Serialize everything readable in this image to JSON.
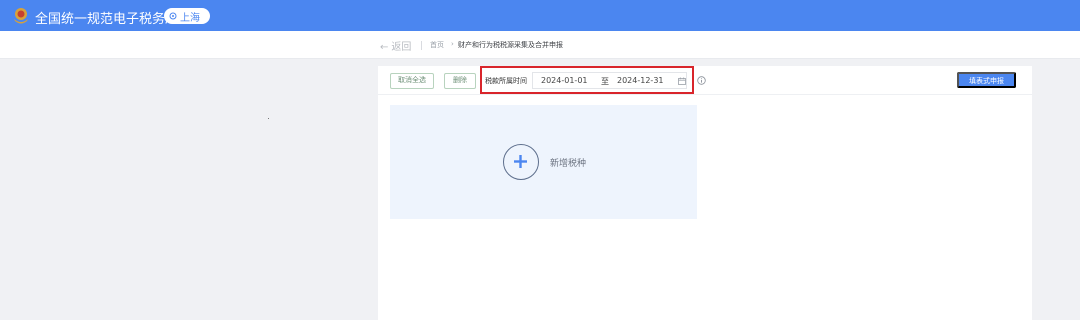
{
  "header": {
    "title": "全国统一规范电子税务局",
    "region": "上海",
    "emblem_icon": "national-emblem-icon",
    "region_icon": "location-icon",
    "background": "#4b86f0"
  },
  "subbar": {
    "back_label": "返回",
    "back_icon": "arrow-left-icon",
    "breadcrumb": {
      "home": "首页",
      "separator": "›",
      "current": "财产和行为税税源采集及合并申报"
    }
  },
  "toolbar": {
    "cancel_all_label": "取消全选",
    "delete_label": "删除",
    "date_label": "税款所属时间",
    "date_start": "2024-01-01",
    "date_separator": "至",
    "date_end": "2024-12-31",
    "calendar_icon": "calendar-icon",
    "info_icon": "info-icon",
    "submit_label": "填表式申报",
    "highlight_color": "#d9252b"
  },
  "add_card": {
    "label": "新增税种",
    "icon": "plus-circle-icon",
    "background": "#eef4fd"
  }
}
